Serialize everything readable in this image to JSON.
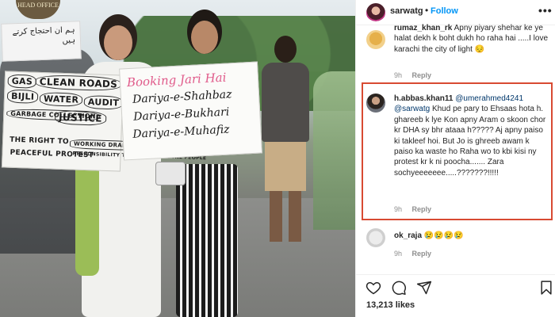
{
  "photo": {
    "head_office_sign": "HEAD OFFICE",
    "top_banner_text": "ہم ان احتجاج کرتے ہیں",
    "placard_left": {
      "words": [
        "GAS",
        "CLEAN ROADS",
        "BIJLI",
        "WATER",
        "AUDIT",
        "GARBAGE COLLECTION",
        "JUSTICE",
        "THE RIGHT TO",
        "PEACEFUL PROTEST",
        "WORKING DRAINS",
        "RESPONSIBILITY THAT WORK FOR THE PEOPLE"
      ]
    },
    "placard_right": {
      "lines": [
        "Booking Jari Hai",
        "Dariya-e-Shahbaz",
        "Dariya-e-Bukhari",
        "Dariya-e-Muhafiz"
      ]
    }
  },
  "post": {
    "username": "sarwatg",
    "separator": "•",
    "follow_label": "Follow",
    "more_icon": "more-horizontal-icon",
    "comments": [
      {
        "user": "rumaz_khan_rk",
        "text": "Apny piyary shehar ke ye halat dekh k boht dukh ho raha hai .....I love karachi the city of light 😔",
        "time": "9h",
        "reply_label": "Reply"
      },
      {
        "user": "h.abbas.khan11",
        "mention1": "@umerahmed4241",
        "mention2": "@sarwatg",
        "text": "Khud pe pary to Ehsaas hota h. ghareeb k lye Kon apny Aram o skoon chor kr DHA sy bhr ataaa h????? Aj apny paiso ki takleef hoi. But Jo is ghreeb awam k paiso ka waste ho Raha wo to kbi kisi ny protest kr k ni poocha....... Zara sochyeeeeeee.....???????!!!!!",
        "time": "9h",
        "reply_label": "Reply",
        "highlighted": true
      },
      {
        "user": "ok_raja",
        "text": "😢😢😢😢",
        "time": "9h",
        "reply_label": "Reply"
      }
    ],
    "actions": [
      "heart-icon",
      "comment-icon",
      "share-icon",
      "save-icon"
    ],
    "likes": "13,213 likes"
  },
  "colors": {
    "follow_blue": "#0095f6",
    "highlight_red": "#d84a32",
    "mention_blue": "#00376b",
    "meta_gray": "#8e8e8e"
  }
}
